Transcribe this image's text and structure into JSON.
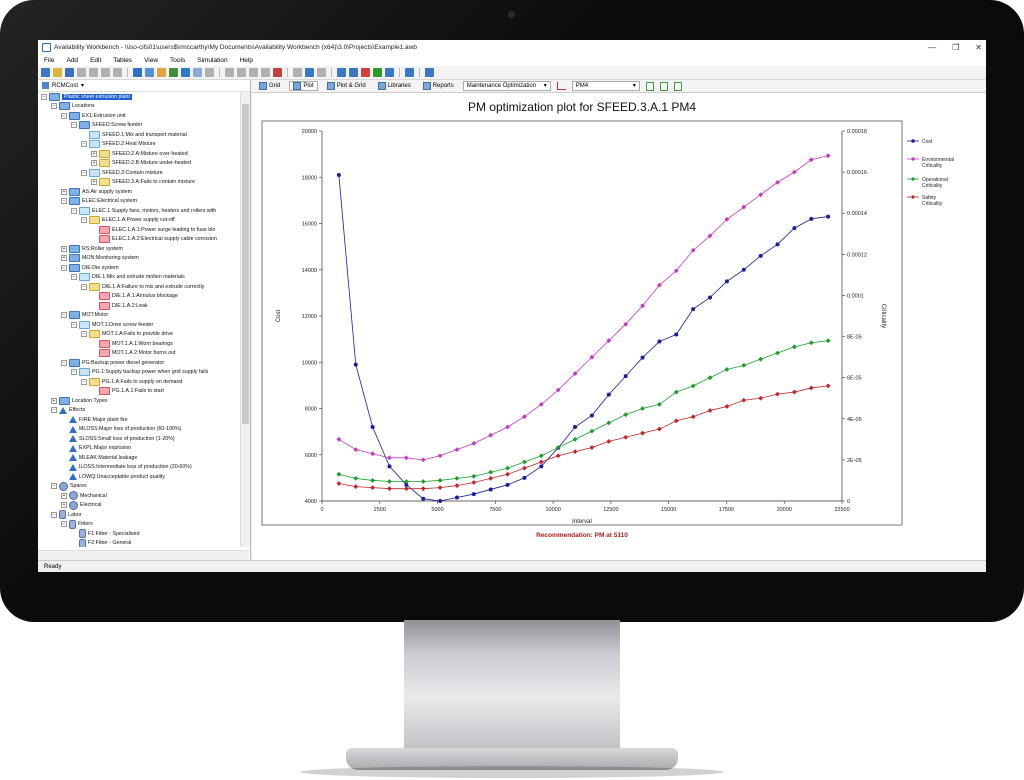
{
  "window": {
    "title": "Availability Workbench - \\\\iso-cifs01\\users$\\rmccarthy\\My Documents\\Availability Workbench (x64)\\3.0\\Projects\\Example1.awb",
    "minimize": "—",
    "maximize": "❐",
    "close": "✕"
  },
  "menu": [
    "File",
    "Add",
    "Edit",
    "Tables",
    "View",
    "Tools",
    "Simulation",
    "Help"
  ],
  "left_panel": {
    "combo_label": "RCMCost",
    "tree": [
      {
        "d": 0,
        "ex": "−",
        "ic": "blue",
        "t": "Plastic sheet extrusion plant",
        "sel": true
      },
      {
        "d": 1,
        "ex": "−",
        "ic": "blue",
        "t": "Locations"
      },
      {
        "d": 2,
        "ex": "−",
        "ic": "blue",
        "t": "EX1:Extrusion unit"
      },
      {
        "d": 3,
        "ex": "−",
        "ic": "blue",
        "t": "SFEED:Screw feeder"
      },
      {
        "d": 4,
        "ex": "",
        "ic": "lblue",
        "t": "SFEED.1:Mix and transport material"
      },
      {
        "d": 4,
        "ex": "−",
        "ic": "lblue",
        "t": "SFEED.2:Heat Mixture"
      },
      {
        "d": 5,
        "ex": "+",
        "ic": "yellow",
        "t": "SFEED.2.A:Mixture over-heated"
      },
      {
        "d": 5,
        "ex": "+",
        "ic": "yellow",
        "t": "SFEED.2.B:Mixture under-heated"
      },
      {
        "d": 4,
        "ex": "−",
        "ic": "lblue",
        "t": "SFEED.3:Contain mixture"
      },
      {
        "d": 5,
        "ex": "+",
        "ic": "yellow",
        "t": "SFEED.3.A:Fails to contain mixture"
      },
      {
        "d": 2,
        "ex": "+",
        "ic": "blue",
        "t": "AS:Air supply system"
      },
      {
        "d": 2,
        "ex": "−",
        "ic": "blue",
        "t": "ELEC:Electrical system"
      },
      {
        "d": 3,
        "ex": "−",
        "ic": "lblue",
        "t": "ELEC.1:Supply fans, motors, heaters and rollers with"
      },
      {
        "d": 4,
        "ex": "−",
        "ic": "yellow",
        "t": "ELEC.1.A:Power supply cut-off"
      },
      {
        "d": 5,
        "ex": "",
        "ic": "red",
        "t": "ELEC.1.A.1:Power surge leading to fuse blo"
      },
      {
        "d": 5,
        "ex": "",
        "ic": "red",
        "t": "ELEC.1.A.2:Electrical supply cable corrosion"
      },
      {
        "d": 2,
        "ex": "+",
        "ic": "blue",
        "t": "RS:Roller system"
      },
      {
        "d": 2,
        "ex": "+",
        "ic": "blue",
        "t": "MON:Monitoring system"
      },
      {
        "d": 2,
        "ex": "−",
        "ic": "blue",
        "t": "DIE:Die system"
      },
      {
        "d": 3,
        "ex": "−",
        "ic": "lblue",
        "t": "DIE.1:Mix and extrude molten materials"
      },
      {
        "d": 4,
        "ex": "−",
        "ic": "yellow",
        "t": "DIE.1.A:Failure to mix and extrude correctly"
      },
      {
        "d": 5,
        "ex": "",
        "ic": "red",
        "t": "DIE.1.A.1:Annulus blockage"
      },
      {
        "d": 5,
        "ex": "",
        "ic": "red",
        "t": "DIE.1.A.2:Leak"
      },
      {
        "d": 2,
        "ex": "−",
        "ic": "blue",
        "t": "MOT:Motor"
      },
      {
        "d": 3,
        "ex": "−",
        "ic": "lblue",
        "t": "MOT.1:Drive screw feeder"
      },
      {
        "d": 4,
        "ex": "−",
        "ic": "yellow",
        "t": "MOT.1.A:Fails to provide drive"
      },
      {
        "d": 5,
        "ex": "",
        "ic": "red",
        "t": "MOT.1.A.1:Worn bearings"
      },
      {
        "d": 5,
        "ex": "",
        "ic": "red",
        "t": "MOT.1.A.2:Motor burns out"
      },
      {
        "d": 2,
        "ex": "−",
        "ic": "blue",
        "t": "PG:Backup power diesel generator"
      },
      {
        "d": 3,
        "ex": "−",
        "ic": "lblue",
        "t": "PG.1:Supply backup power when grid supply fails"
      },
      {
        "d": 4,
        "ex": "−",
        "ic": "yellow",
        "t": "PG.1.A:Fails to supply on demand"
      },
      {
        "d": 5,
        "ex": "",
        "ic": "red",
        "t": "PG.1.A.1:Fails to start"
      },
      {
        "d": 1,
        "ex": "+",
        "ic": "blue",
        "t": "Location Types"
      },
      {
        "d": 1,
        "ex": "−",
        "ic": "tri",
        "t": "Effects"
      },
      {
        "d": 2,
        "ex": "",
        "ic": "tri",
        "t": "FIRE:Major plant fire"
      },
      {
        "d": 2,
        "ex": "",
        "ic": "tri",
        "t": "MLOSS:Major loss of production (60-100%)"
      },
      {
        "d": 2,
        "ex": "",
        "ic": "tri",
        "t": "SLOSS:Small loss of production (1-20%)"
      },
      {
        "d": 2,
        "ex": "",
        "ic": "tri",
        "t": "EXPL:Major explosion"
      },
      {
        "d": 2,
        "ex": "",
        "ic": "tri",
        "t": "MLEAK:Material leakage"
      },
      {
        "d": 2,
        "ex": "",
        "ic": "tri",
        "t": "ILOSS:Intermediate loss of production (20-60%)"
      },
      {
        "d": 2,
        "ex": "",
        "ic": "tri",
        "t": "LOWQ:Unacceptable product quality"
      },
      {
        "d": 1,
        "ex": "−",
        "ic": "gear",
        "t": "Spares"
      },
      {
        "d": 2,
        "ex": "+",
        "ic": "gear",
        "t": "Mechanical"
      },
      {
        "d": 2,
        "ex": "+",
        "ic": "gear",
        "t": "Electrical"
      },
      {
        "d": 1,
        "ex": "−",
        "ic": "person",
        "t": "Labor"
      },
      {
        "d": 2,
        "ex": "−",
        "ic": "person",
        "t": "Fitters"
      },
      {
        "d": 3,
        "ex": "",
        "ic": "person",
        "t": "F1:Fitter - Specialised"
      },
      {
        "d": 3,
        "ex": "",
        "ic": "person",
        "t": "F2:Fitter - General"
      }
    ]
  },
  "tabs": [
    {
      "label": "Grid"
    },
    {
      "label": "Plot",
      "active": true
    },
    {
      "label": "Plot & Grid"
    },
    {
      "label": "Libraries"
    },
    {
      "label": "Reports"
    }
  ],
  "toolbar2": {
    "mode_select": "Maintenance Optimization",
    "task_select": "PM4"
  },
  "status_bar": "Ready",
  "chart_data": {
    "type": "line",
    "title": "PM optimization plot for SFEED.3.A.1 PM4",
    "xlabel": "Interval",
    "ylabel": "Cost",
    "y2label": "Criticality",
    "xlim": [
      0,
      22500
    ],
    "ylim": [
      4000,
      20000
    ],
    "y2lim": [
      0,
      0.00018
    ],
    "x_ticks": [
      "0",
      "2500",
      "5000",
      "7500",
      "10000",
      "12500",
      "15000",
      "17500",
      "20000",
      "22500"
    ],
    "y_ticks": [
      "4000",
      "6000",
      "8000",
      "10000",
      "12000",
      "14000",
      "16000",
      "18000",
      "20000"
    ],
    "y2_ticks": [
      "0",
      "2E-05",
      "4E-05",
      "6E-05",
      "8E-05",
      "0.0001",
      "0.00012",
      "0.00014",
      "0.00016",
      "0.00018"
    ],
    "legend_position": "right",
    "recommendation": "Recommendation: PM at 5110",
    "x": [
      730,
      1460,
      2190,
      2920,
      3650,
      4380,
      5110,
      5840,
      6570,
      7300,
      8030,
      8760,
      9490,
      10220,
      10950,
      11680,
      12410,
      13140,
      13870,
      14600,
      15330,
      16060,
      16790,
      17520,
      18250,
      18980,
      19710,
      20440,
      21170,
      21900
    ],
    "series": [
      {
        "name": "Cost",
        "color": "#1c1c9e",
        "axis": "left",
        "values": [
          18100,
          9900,
          7200,
          5500,
          4700,
          4100,
          4000,
          4150,
          4300,
          4500,
          4700,
          5000,
          5500,
          6300,
          7200,
          7700,
          8600,
          9400,
          10200,
          10900,
          11200,
          12300,
          12800,
          13500,
          14000,
          14600,
          15100,
          15800,
          16200,
          16300
        ]
      },
      {
        "name": "Environmental Criticality",
        "color": "#c23ac2",
        "axis": "right",
        "values": [
          3e-05,
          2.5e-05,
          2.3e-05,
          2.1e-05,
          2.1e-05,
          2e-05,
          2.2e-05,
          2.5e-05,
          2.8e-05,
          3.2e-05,
          3.6e-05,
          4.1e-05,
          4.7e-05,
          5.4e-05,
          6.2e-05,
          7e-05,
          7.8e-05,
          8.6e-05,
          9.5e-05,
          0.000105,
          0.000112,
          0.000122,
          0.000129,
          0.000137,
          0.000143,
          0.000149,
          0.000155,
          0.00016,
          0.000166,
          0.000168
        ]
      },
      {
        "name": "Operational Criticality",
        "color": "#1a9e2a",
        "axis": "right",
        "values": [
          1.3e-05,
          1.1e-05,
          1e-05,
          9.5e-06,
          9.5e-06,
          9.5e-06,
          1e-05,
          1.1e-05,
          1.2e-05,
          1.4e-05,
          1.6e-05,
          1.9e-05,
          2.2e-05,
          2.6e-05,
          3e-05,
          3.4e-05,
          3.8e-05,
          4.2e-05,
          4.5e-05,
          4.7e-05,
          5.3e-05,
          5.6e-05,
          6e-05,
          6.4e-05,
          6.6e-05,
          6.9e-05,
          7.2e-05,
          7.5e-05,
          7.7e-05,
          7.8e-05
        ]
      },
      {
        "name": "Safety Criticality",
        "color": "#c0262b",
        "axis": "right",
        "values": [
          8.5e-06,
          7e-06,
          6.5e-06,
          6e-06,
          6e-06,
          6e-06,
          6.5e-06,
          7.5e-06,
          9e-06,
          1.1e-05,
          1.3e-05,
          1.6e-05,
          1.9e-05,
          2.2e-05,
          2.4e-05,
          2.6e-05,
          2.9e-05,
          3.1e-05,
          3.3e-05,
          3.5e-05,
          3.9e-05,
          4.1e-05,
          4.4e-05,
          4.6e-05,
          4.9e-05,
          5e-05,
          5.2e-05,
          5.3e-05,
          5.5e-05,
          5.6e-05
        ]
      }
    ]
  }
}
